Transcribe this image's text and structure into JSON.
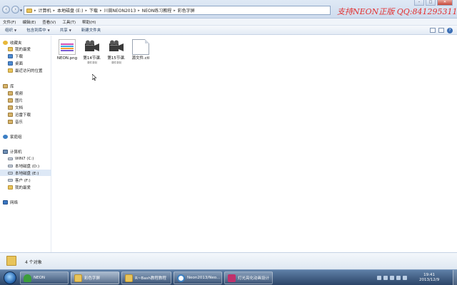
{
  "address_bar": {
    "crumbs": [
      "计算机",
      "本地磁盘 (E:)",
      "下载",
      "川田NEON2013",
      "NEON练习教程",
      "彩色字屏"
    ]
  },
  "watermark": "支持NEON正版 QQ:841295311",
  "menu": [
    "文件(F)",
    "编辑(E)",
    "查看(V)",
    "工具(T)",
    "帮助(H)"
  ],
  "toolbar": {
    "organize": "组织",
    "include": "包含到库中",
    "share": "共享",
    "new_folder": "新建文件夹"
  },
  "navpane": {
    "favorites": "收藏夹",
    "fav_items": [
      "我的最爱",
      "下载",
      "桌面",
      "最近访问的位置"
    ],
    "libraries": "库",
    "lib_items": [
      "视频",
      "图片",
      "文档",
      "迅雷下载",
      "音乐"
    ],
    "homegroup": "家庭组",
    "computer": "计算机",
    "drives": [
      "WIN7 (C:)",
      "本地磁盘 (D:)",
      "本地磁盘 (E:)",
      "客户 (F:)",
      "我的最爱"
    ],
    "network": "网络"
  },
  "files": [
    {
      "name": "NEON.png",
      "type": "png",
      "sub": ""
    },
    {
      "name": "第14节课.",
      "type": "video",
      "sub": "课件录制"
    },
    {
      "name": "第15节课.",
      "type": "video",
      "sub": "课件录制"
    },
    {
      "name": "源文件.ctl",
      "type": "doc",
      "sub": ""
    }
  ],
  "details": {
    "count": "4 个对象"
  },
  "taskbar": {
    "items": [
      {
        "label": "NEON",
        "icon": "tree-icon"
      },
      {
        "label": "彩色字屏",
        "icon": "folder-icon"
      },
      {
        "label": "R~Bash教程教程",
        "icon": "folder-icon"
      },
      {
        "label": "Neon2013/Neo...",
        "icon": "s-icon"
      },
      {
        "label": "灯光亮化动画设计",
        "icon": "app-icon"
      }
    ],
    "time": "19:41",
    "date": "2013/12/9"
  },
  "colors": {
    "watermark": "#e23030",
    "selection": "#dde8f6",
    "taskbar": "#2c4568"
  }
}
